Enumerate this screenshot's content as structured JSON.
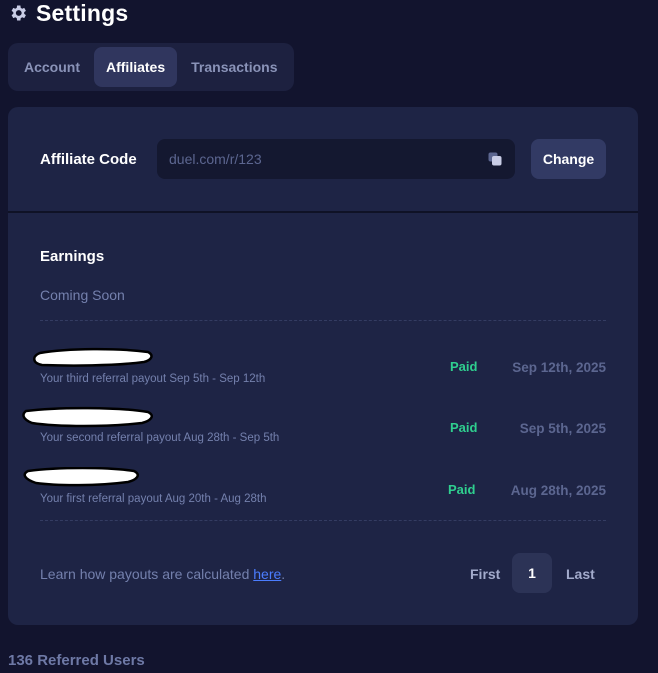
{
  "header": {
    "title": "Settings",
    "icon": "gear-icon"
  },
  "tabs": [
    {
      "label": "Account",
      "active": false
    },
    {
      "label": "Affiliates",
      "active": true
    },
    {
      "label": "Transactions",
      "active": false
    }
  ],
  "affiliate": {
    "label": "Affiliate Code",
    "code_value": "duel.com/r/123",
    "copy_icon": "copy-icon",
    "change_label": "Change"
  },
  "earnings": {
    "title": "Earnings",
    "status_text": "Coming Soon"
  },
  "payouts": [
    {
      "description": "Your third referral payout Sep 5th - Sep 12th",
      "status": "Paid",
      "date": "Sep 12th, 2025"
    },
    {
      "description": "Your second referral payout Aug 28th - Sep 5th",
      "status": "Paid",
      "date": "Sep 5th, 2025"
    },
    {
      "description": "Your first referral payout Aug 20th - Aug 28th",
      "status": "Paid",
      "date": "Aug 28th, 2025"
    }
  ],
  "footer": {
    "learn_prefix": "Learn how payouts are calculated ",
    "learn_link": "here",
    "learn_suffix": ".",
    "first_label": "First",
    "page_number": "1",
    "last_label": "Last"
  },
  "referred_users": "136 Referred Users",
  "colors": {
    "background": "#12142e",
    "card": "#1e2445",
    "paid_green": "#2fcf8f",
    "link_blue": "#4b7dff"
  }
}
